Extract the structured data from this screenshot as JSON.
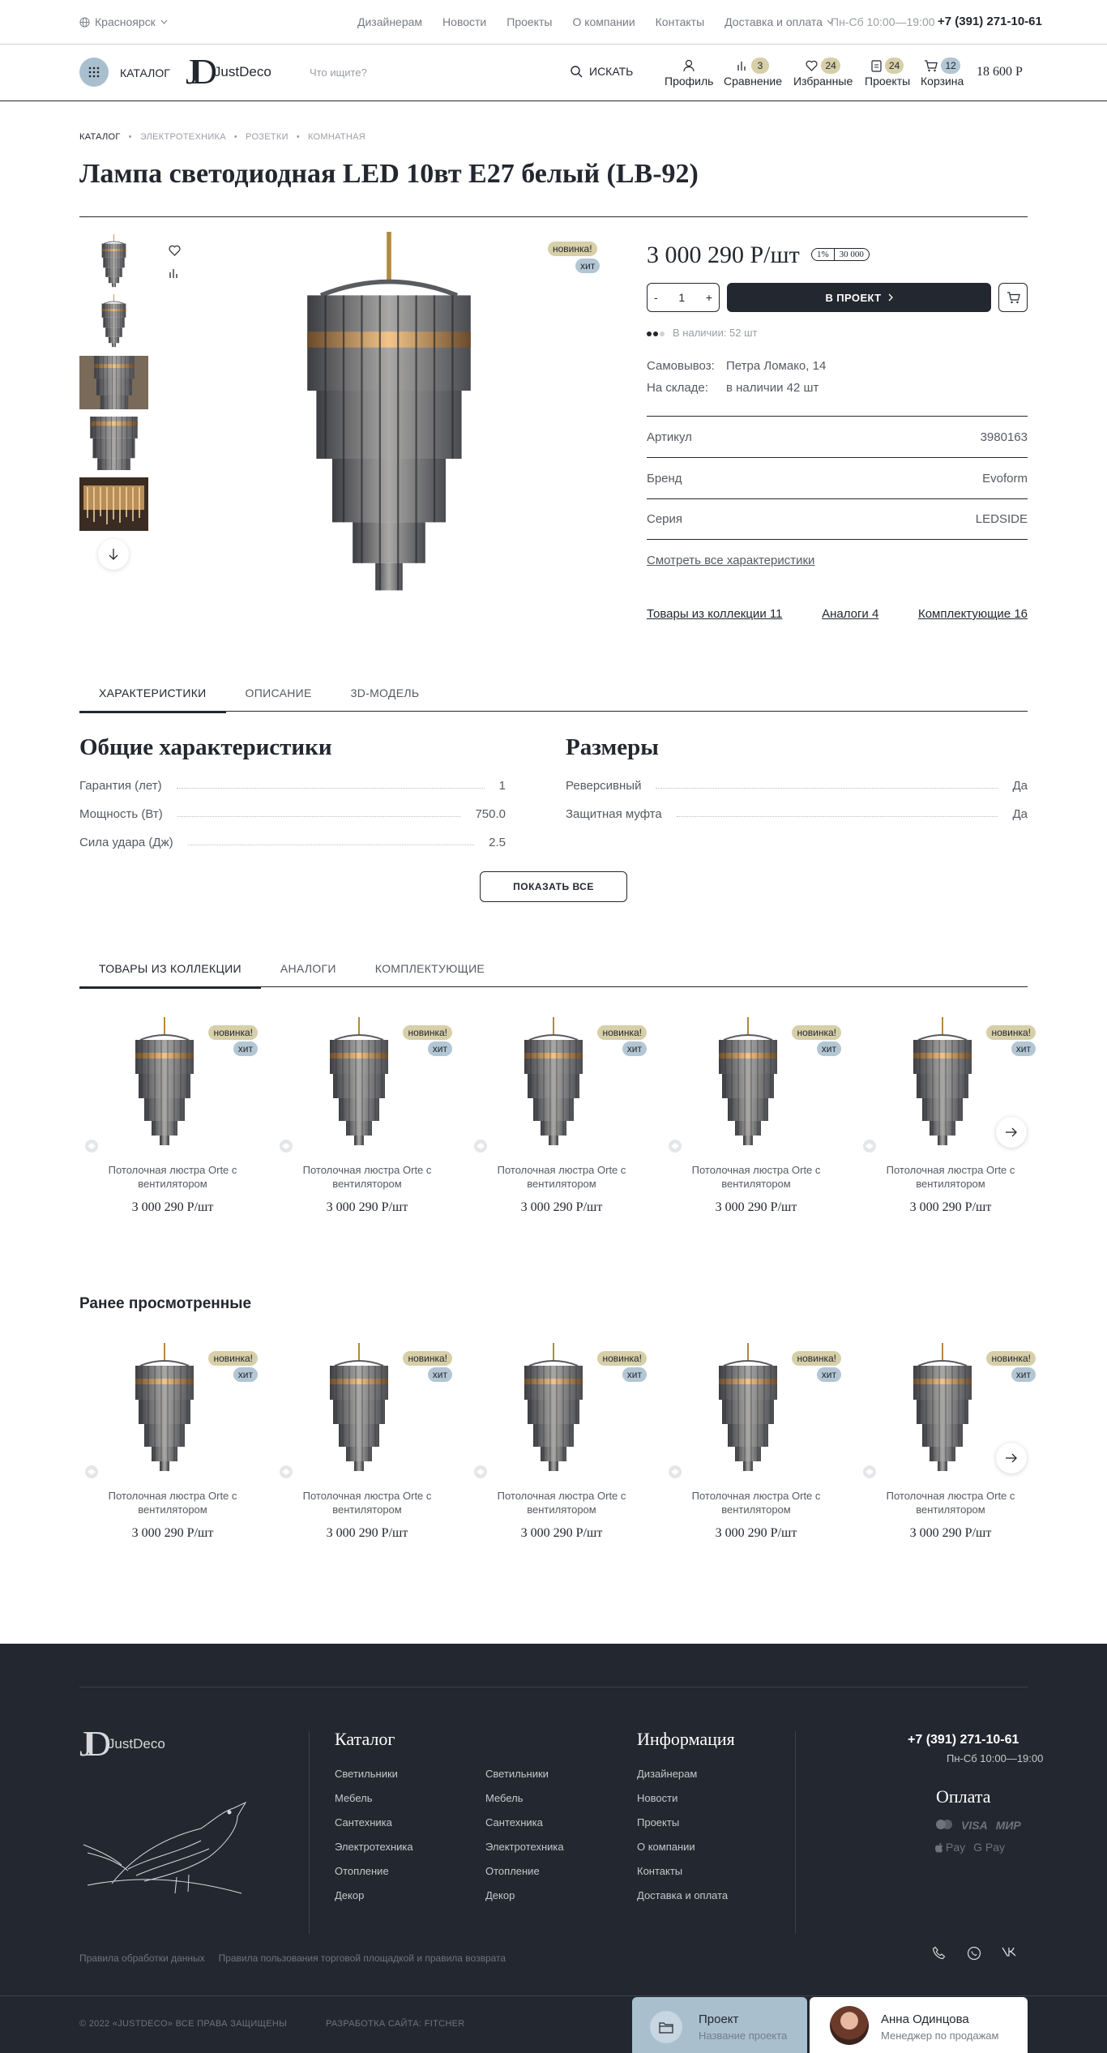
{
  "topbar": {
    "city": "Красноярск",
    "nav": [
      "Дизайнерам",
      "Новости",
      "Проекты",
      "О компании",
      "Контакты",
      "Доставка и оплата"
    ],
    "hours": "Пн-Сб 10:00—19:00",
    "phone": "+7 (391) 271-10-61"
  },
  "header": {
    "catalog_label": "КАТАЛОГ",
    "logo_text": "JustDeco",
    "search_placeholder": "Что ищите?",
    "search_button": "ИСКАТЬ",
    "profile": "Профиль",
    "compare": "Сравнение",
    "compare_count": "3",
    "favorites": "Избранные",
    "favorites_count": "24",
    "projects": "Проекты",
    "projects_count": "24",
    "cart": "Корзина",
    "cart_count": "12",
    "cart_sum": "18 600 Р"
  },
  "breadcrumbs": [
    "КАТАЛОГ",
    "ЭЛЕКТРОТЕХНИКА",
    "РОЗЕТКИ",
    "КОМНАТНАЯ"
  ],
  "product": {
    "title": "Лампа светодиодная LED 10вт E27 белый (LB-92)",
    "tag_new": "новинка!",
    "tag_hit": "хит",
    "price": "3 000 290 Р/шт",
    "price_tag_a": "1%",
    "price_tag_b": "30 000",
    "quantity": "1",
    "qty_minus": "-",
    "qty_plus": "+",
    "to_project": "В ПРОЕКТ",
    "stock_text": "В наличии: 52 шт",
    "stock_level": 0.67,
    "pickup_label": "Самовывоз:",
    "pickup_value": "Петра Ломако, 14",
    "warehouse_label": "На складе:",
    "warehouse_value": "в наличии 42 шт",
    "specs": [
      {
        "label": "Артикул",
        "value": "3980163"
      },
      {
        "label": "Бренд",
        "value": "Evoform"
      },
      {
        "label": "Серия",
        "value": "LEDSIDE"
      }
    ],
    "all_specs_link": "Смотреть все характеристики",
    "related_links": [
      "Товары из коллекции 11",
      "Аналоги 4",
      "Комплектующие 16"
    ]
  },
  "detail_tabs": [
    "ХАРАКТЕРИСТИКИ",
    "ОПИСАНИЕ",
    "3D-МОДЕЛЬ"
  ],
  "characteristics": {
    "general_title": "Общие характеристики",
    "general": [
      {
        "label": "Гарантия (лет)",
        "value": "1"
      },
      {
        "label": "Мощность (Вт)",
        "value": "750.0"
      },
      {
        "label": "Сила удара (Дж)",
        "value": "2.5"
      }
    ],
    "sizes_title": "Размеры",
    "sizes": [
      {
        "label": "Реверсивный",
        "value": "Да"
      },
      {
        "label": "Защитная муфта",
        "value": "Да"
      }
    ],
    "show_all": "ПОКАЗАТЬ ВСЕ"
  },
  "collection_tabs": [
    "ТОВАРЫ ИЗ КОЛЛЕКЦИИ",
    "АНАЛОГИ",
    "КОМПЛЕКТУЮЩИЕ"
  ],
  "collection_items": [
    {
      "name": "Потолочная люстра Orte с вентилятором",
      "price": "3 000 290 Р/шт"
    },
    {
      "name": "Потолочная люстра Orte с вентилятором",
      "price": "3 000 290 Р/шт"
    },
    {
      "name": "Потолочная люстра Orte с вентилятором",
      "price": "3 000 290 Р/шт"
    },
    {
      "name": "Потолочная люстра Orte с вентилятором",
      "price": "3 000 290 Р/шт"
    },
    {
      "name": "Потолочная люстра Orte с вентилятором",
      "price": "3 000 290 Р/шт"
    }
  ],
  "recently_viewed_title": "Ранее просмотренные",
  "recent_items": [
    {
      "name": "Потолочная люстра Orte с вентилятором",
      "price": "3 000 290 Р/шт"
    },
    {
      "name": "Потолочная люстра Orte с вентилятором",
      "price": "3 000 290 Р/шт"
    },
    {
      "name": "Потолочная люстра Orte с вентилятором",
      "price": "3 000 290 Р/шт"
    },
    {
      "name": "Потолочная люстра Orte с вентилятором",
      "price": "3 000 290 Р/шт"
    },
    {
      "name": "Потолочная люстра Orte с вентилятором",
      "price": "3 000 290 Р/шт"
    }
  ],
  "footer": {
    "logo_text": "JustDeco",
    "catalog_title": "Каталог",
    "catalog_col1": [
      "Светильники",
      "Мебель",
      "Сантехника",
      "Электротехника",
      "Отопление",
      "Декор"
    ],
    "catalog_col2": [
      "Светильники",
      "Мебель",
      "Сантехника",
      "Электротехника",
      "Отопление",
      "Декор"
    ],
    "info_title": "Информация",
    "info_links": [
      "Дизайнерам",
      "Новости",
      "Проекты",
      "О компании",
      "Контакты",
      "Доставка и оплата"
    ],
    "phone": "+7 (391) 271-10-61",
    "hours": "Пн-Сб 10:00—19:00",
    "payment_title": "Оплата",
    "payment_row1": [
      "VISA",
      "МИР"
    ],
    "payment_row2": [
      "Pay",
      "G Pay"
    ],
    "legal_links": [
      "Правила обработки данных",
      "Правила пользования торговой площадкой и правила возврата"
    ],
    "copyright": "© 2022 «JUSTDECO» ВСЕ ПРАВА ЗАЩИЩЕНЫ",
    "developer": "РАЗРАБОТКА САЙТА: FITCHER"
  },
  "widgets": {
    "project_title": "Проект",
    "project_sub": "Название проекта",
    "manager_name": "Анна Одинцова",
    "manager_role": "Менеджер по продажам"
  },
  "colors": {
    "dark": "#23272f",
    "accent_blue": "#a9bfcd",
    "badge_gold": "#d6cfa8"
  }
}
